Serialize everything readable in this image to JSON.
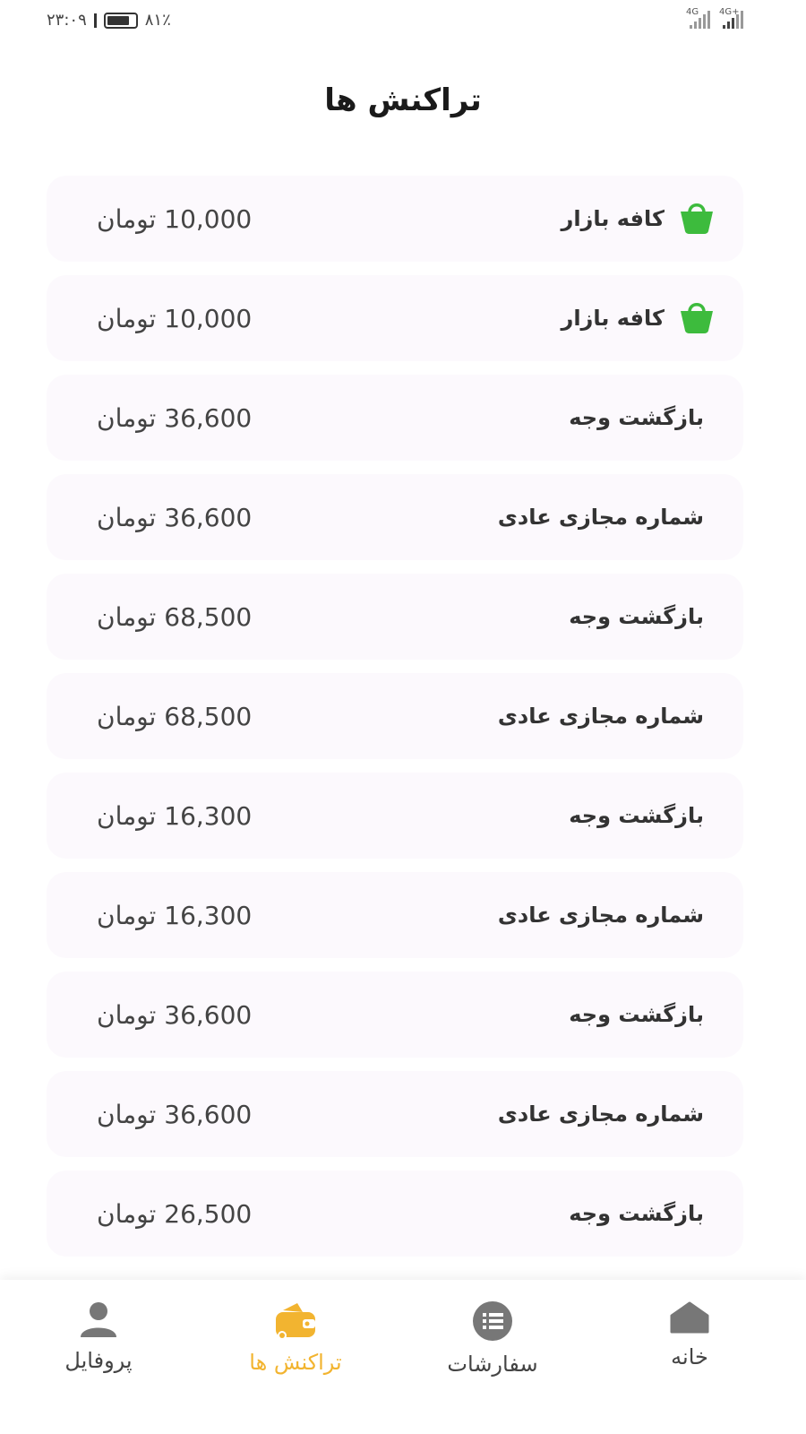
{
  "status_bar": {
    "time": "۲۳:۰۹",
    "battery": "۸۱٪",
    "battery_level": 0.81,
    "network_1": "4G",
    "network_2": "4G+"
  },
  "page_title": "تراکنش ها",
  "transactions": [
    {
      "label": "کافه بازار",
      "amount": "10,000 تومان",
      "icon": "bazaar-bag-icon"
    },
    {
      "label": "کافه بازار",
      "amount": "10,000 تومان",
      "icon": "bazaar-bag-icon"
    },
    {
      "label": "بازگشت وجه",
      "amount": "36,600 تومان",
      "icon": ""
    },
    {
      "label": "شماره مجازی عادی",
      "amount": "36,600 تومان",
      "icon": ""
    },
    {
      "label": "بازگشت وجه",
      "amount": "68,500 تومان",
      "icon": ""
    },
    {
      "label": "شماره مجازی عادی",
      "amount": "68,500 تومان",
      "icon": ""
    },
    {
      "label": "بازگشت وجه",
      "amount": "16,300 تومان",
      "icon": ""
    },
    {
      "label": "شماره مجازی عادی",
      "amount": "16,300 تومان",
      "icon": ""
    },
    {
      "label": "بازگشت وجه",
      "amount": "36,600 تومان",
      "icon": ""
    },
    {
      "label": "شماره مجازی عادی",
      "amount": "36,600 تومان",
      "icon": ""
    },
    {
      "label": "بازگشت وجه",
      "amount": "26,500 تومان",
      "icon": ""
    }
  ],
  "nav": {
    "home": {
      "label": "خانه",
      "icon": "home-icon"
    },
    "orders": {
      "label": "سفارشات",
      "icon": "list-icon"
    },
    "transactions": {
      "label": "تراکنش ها",
      "icon": "wallet-icon",
      "active": true
    },
    "profile": {
      "label": "پروفایل",
      "icon": "person-icon"
    }
  },
  "colors": {
    "accent": "#f2b430",
    "row_bg": "#fcf9fd",
    "bazaar_green": "#3dbb3d",
    "nav_icon": "#777777"
  }
}
